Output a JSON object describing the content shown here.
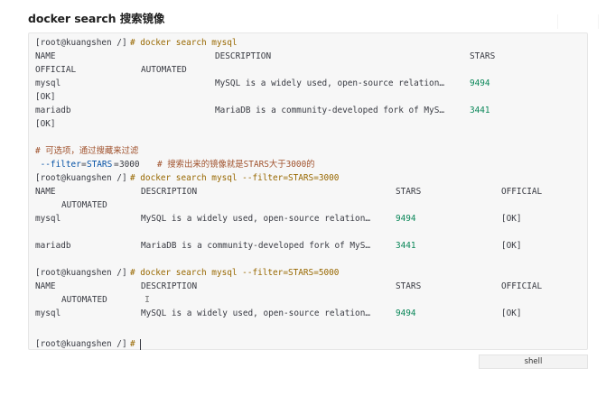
{
  "heading": "docker search 搜索镜像",
  "code_language": "shell",
  "lines": {
    "l1": {
      "prompt": "[root@kuangshen /]",
      "cmd": "# docker search mysql"
    },
    "l2": {
      "c1": "NAME",
      "c2": "DESCRIPTION",
      "c3": "STARS"
    },
    "l3": {
      "c1": "OFFICIAL",
      "c2": "AUTOMATED"
    },
    "l4": {
      "c1": "mysql",
      "c2": "MySQL is a widely used, open-source relation…",
      "c3": "9494"
    },
    "l5": {
      "c1": "[OK]"
    },
    "l6": {
      "c1": "mariadb",
      "c2": "MariaDB is a community-developed fork of MyS…",
      "c3": "3441"
    },
    "l7": {
      "c1": "[OK]"
    },
    "l9": {
      "c1": "# 可选项，通过搜藏来过滤"
    },
    "l10": {
      "flag": " --filter",
      "eq": "=",
      "key": "STARS",
      "eq2": "=",
      "num": "3000",
      "comment": "# 搜索出来的镜像就是STARS大于3000的"
    },
    "l11": {
      "prompt": "[root@kuangshen /]",
      "cmd": "# docker search mysql --filter=STARS=3000"
    },
    "l12": {
      "c1": "NAME",
      "c2": "DESCRIPTION",
      "c3": "STARS",
      "c4": "OFFICIAL"
    },
    "l13": {
      "c1": "AUTOMATED"
    },
    "l14": {
      "c1": "mysql",
      "c2": "MySQL is a widely used, open-source relation…",
      "c3": "9494",
      "c4": "[OK]"
    },
    "l16": {
      "c1": "mariadb",
      "c2": "MariaDB is a community-developed fork of MyS…",
      "c3": "3441",
      "c4": "[OK]"
    },
    "l18": {
      "prompt": "[root@kuangshen /]",
      "cmd": "# docker search mysql --filter=STARS=5000"
    },
    "l19": {
      "c1": "NAME",
      "c2": "DESCRIPTION",
      "c3": "STARS",
      "c4": "OFFICIAL"
    },
    "l20": {
      "c1": "AUTOMATED"
    },
    "l21": {
      "c1": "mysql",
      "c2": "MySQL is a widely used, open-source relation…",
      "c3": "9494",
      "c4": "[OK]"
    },
    "l23": {
      "prompt": "[root@kuangshen /]",
      "cmd": "#"
    }
  }
}
